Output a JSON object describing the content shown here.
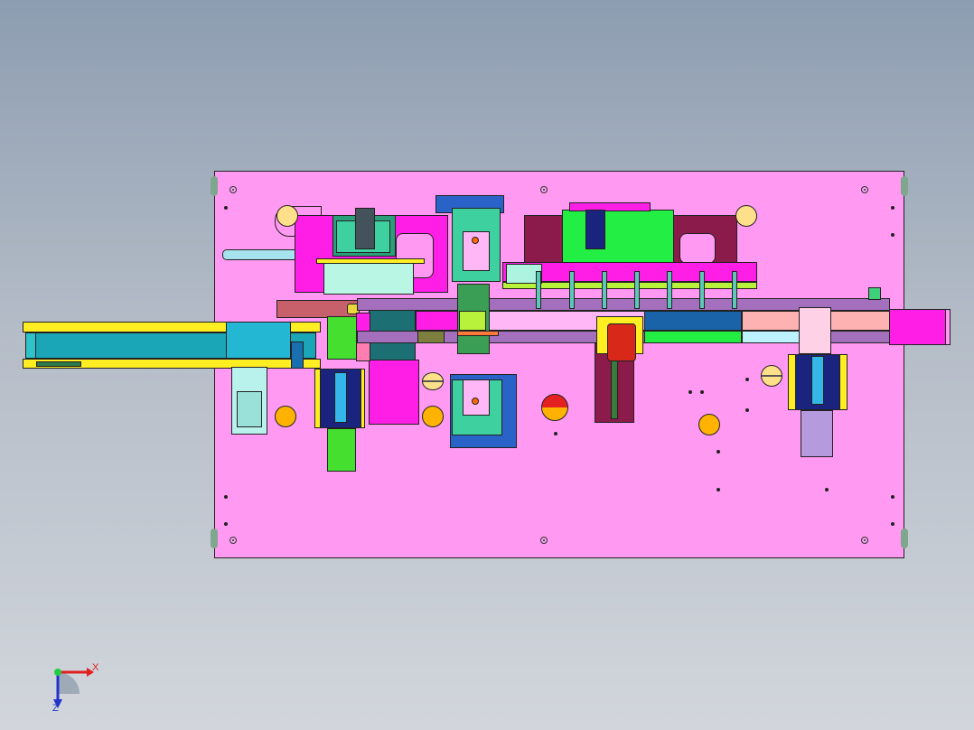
{
  "viewport": {
    "background": "gradient-gray-blue",
    "colors": {
      "base_plate": "#ff99f2",
      "magenta": "#ff1ee6",
      "green": "#22ee44",
      "teal": "#1aa6b6",
      "navy": "#1a237e",
      "yellow": "#ffee22",
      "orange": "#ffb300",
      "maroon": "#8a1b4a",
      "blue": "#2a63c7"
    }
  },
  "triad": {
    "x_label": "X",
    "z_label": "Z",
    "icon": "axis-triad-icon"
  }
}
